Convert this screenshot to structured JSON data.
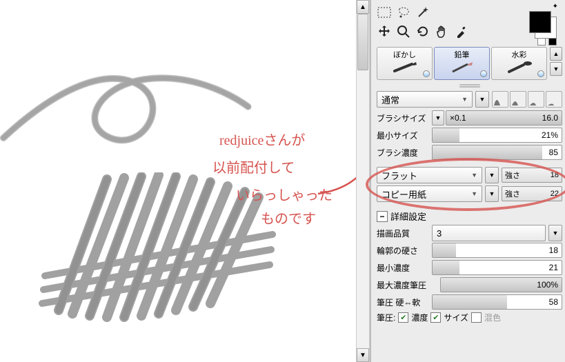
{
  "annotation": {
    "line1": "redjuiceさんが",
    "line2": "以前配付して",
    "line3": "いらっしゃった",
    "line4": "ものです"
  },
  "brush_tabs": [
    {
      "label": "ぼかし"
    },
    {
      "label": "鉛筆"
    },
    {
      "label": "水彩"
    }
  ],
  "blend_mode": "通常",
  "params": {
    "brush_size": {
      "label": "ブラシサイズ",
      "left": "×0.1",
      "right": "16.0",
      "fill": 100
    },
    "min_size": {
      "label": "最小サイズ",
      "left": "",
      "right": "21%",
      "fill": 21
    },
    "density": {
      "label": "ブラシ濃度",
      "left": "",
      "right": "85",
      "fill": 85
    },
    "texture1": {
      "name": "フラット",
      "sub": "強さ",
      "val": "18"
    },
    "texture2": {
      "name": "コピー用紙",
      "sub": "強さ",
      "val": "22"
    },
    "advanced_label": "詳細設定",
    "quality": {
      "label": "描画品質",
      "value": "3"
    },
    "edge_hardness": {
      "label": "輪郭の硬さ",
      "left": "",
      "right": "18",
      "fill": 18
    },
    "min_density": {
      "label": "最小濃度",
      "left": "",
      "right": "21",
      "fill": 21
    },
    "max_density_pr": {
      "label": "最大濃度筆圧",
      "left": "",
      "right": "100%",
      "fill": 100
    },
    "hard_soft": {
      "label": "筆圧 硬⇔軟",
      "left": "",
      "right": "58",
      "fill": 58
    }
  },
  "bottom": {
    "pressure_label": "筆圧: ",
    "density": "濃度",
    "size": "サイズ",
    "blend": "混色"
  }
}
